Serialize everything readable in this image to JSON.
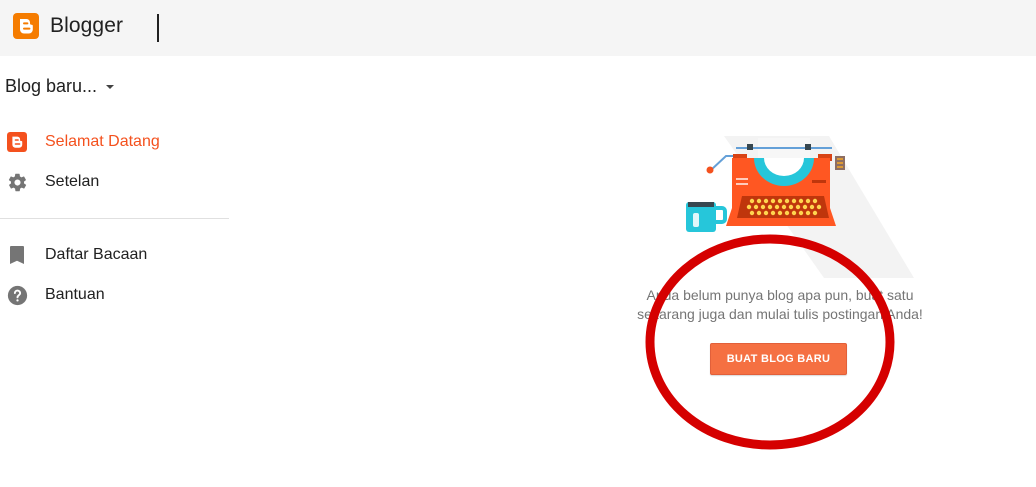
{
  "app": {
    "title": "Blogger",
    "brand_color": "#f57c00"
  },
  "blog_selector": {
    "label": "Blog baru..."
  },
  "sidebar": {
    "items": [
      {
        "label": "Selamat Datang",
        "icon": "blogger-icon",
        "active": true
      },
      {
        "label": "Setelan",
        "icon": "gear-icon",
        "active": false
      },
      {
        "label": "Daftar Bacaan",
        "icon": "bookmark-icon",
        "active": false
      },
      {
        "label": "Bantuan",
        "icon": "help-icon",
        "active": false
      }
    ],
    "active_color": "#f4511e"
  },
  "main": {
    "illustration": "typewriter-and-mug-illustration",
    "empty_message_line1": "Anda belum punya blog apa pun, buat satu",
    "empty_message_line2": "sekarang juga dan mulai tulis postingan Anda!",
    "create_button_label": "BUAT BLOG BARU",
    "button_color": "#f57042"
  },
  "annotation": {
    "shape": "ellipse",
    "color": "#d50000"
  }
}
